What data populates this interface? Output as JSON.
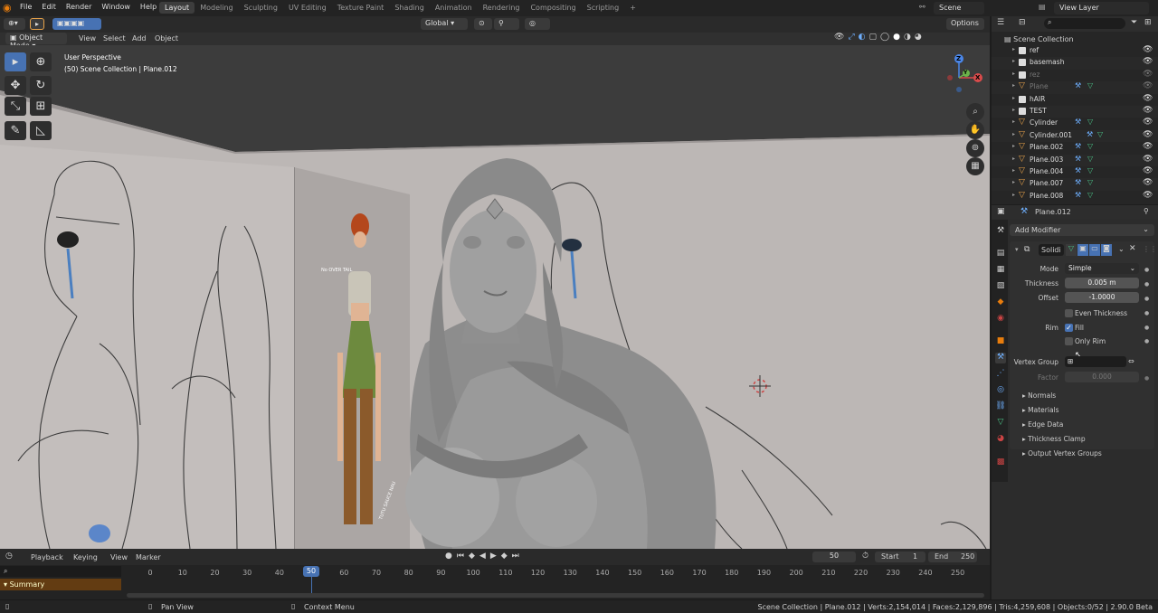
{
  "topbar": {
    "menu": [
      "File",
      "Edit",
      "Render",
      "Window",
      "Help"
    ],
    "workspaces": [
      "Layout",
      "Modeling",
      "Sculpting",
      "UV Editing",
      "Texture Paint",
      "Shading",
      "Animation",
      "Rendering",
      "Compositing",
      "Scripting"
    ],
    "active_workspace": "Layout",
    "scene": "Scene",
    "view_layer": "View Layer"
  },
  "viewport_header": {
    "mode": "Object Mode",
    "menu": [
      "View",
      "Select",
      "Add",
      "Object"
    ],
    "transform_orientation": "Global",
    "options": "Options"
  },
  "viewport": {
    "perspective": "User Perspective",
    "collection_info": "(50) Scene Collection | Plane.012",
    "sketch_note": "No OVER TAIL",
    "sketch_note2": "TUTU SAUCE NAU"
  },
  "gizmo": {
    "x": "X",
    "y": "Y",
    "z": "Z"
  },
  "outliner": {
    "root": "Scene Collection",
    "items": [
      {
        "name": "ref",
        "type": "collection",
        "checked": true
      },
      {
        "name": "basemash",
        "type": "collection",
        "checked": true
      },
      {
        "name": "rez",
        "type": "collection",
        "checked": true,
        "dim": true
      },
      {
        "name": "Plane",
        "type": "object",
        "dim": true
      },
      {
        "name": "hAIR",
        "type": "collection",
        "checked": true
      },
      {
        "name": "TEST",
        "type": "collection",
        "checked": true
      },
      {
        "name": "Cylinder",
        "type": "object"
      },
      {
        "name": "Cylinder.001",
        "type": "object"
      },
      {
        "name": "Plane.002",
        "type": "object"
      },
      {
        "name": "Plane.003",
        "type": "object"
      },
      {
        "name": "Plane.004",
        "type": "object"
      },
      {
        "name": "Plane.007",
        "type": "object"
      },
      {
        "name": "Plane.008",
        "type": "object"
      }
    ]
  },
  "properties": {
    "object": "Plane.012",
    "add_modifier": "Add Modifier",
    "modifier_name": "Solidi",
    "mode_label": "Mode",
    "mode_value": "Simple",
    "thickness_label": "Thickness",
    "thickness_value": "0.005 m",
    "offset_label": "Offset",
    "offset_value": "-1.0000",
    "even_thickness": "Even Thickness",
    "rim_label": "Rim",
    "fill": "Fill",
    "only_rim": "Only Rim",
    "vertex_group_label": "Vertex Group",
    "factor_label": "Factor",
    "factor_value": "0.000",
    "subpanels": [
      "Normals",
      "Materials",
      "Edge Data",
      "Thickness Clamp",
      "Output Vertex Groups"
    ]
  },
  "timeline": {
    "menu": [
      "Playback",
      "Keying",
      "View",
      "Marker"
    ],
    "current_frame": "50",
    "start_label": "Start",
    "start": "1",
    "end_label": "End",
    "end": "250",
    "ticks": [
      "0",
      "10",
      "20",
      "30",
      "40",
      "50",
      "60",
      "70",
      "80",
      "90",
      "100",
      "110",
      "120",
      "130",
      "140",
      "150",
      "160",
      "170",
      "180",
      "190",
      "200",
      "210",
      "220",
      "230",
      "240",
      "250"
    ],
    "summary": "Summary"
  },
  "statusbar": {
    "pan": "Pan View",
    "context": "Context Menu",
    "stats": "Scene Collection | Plane.012 | Verts:2,154,014 | Faces:2,129,896 | Tris:4,259,608 | Objects:0/52 | 2.90.0 Beta"
  }
}
